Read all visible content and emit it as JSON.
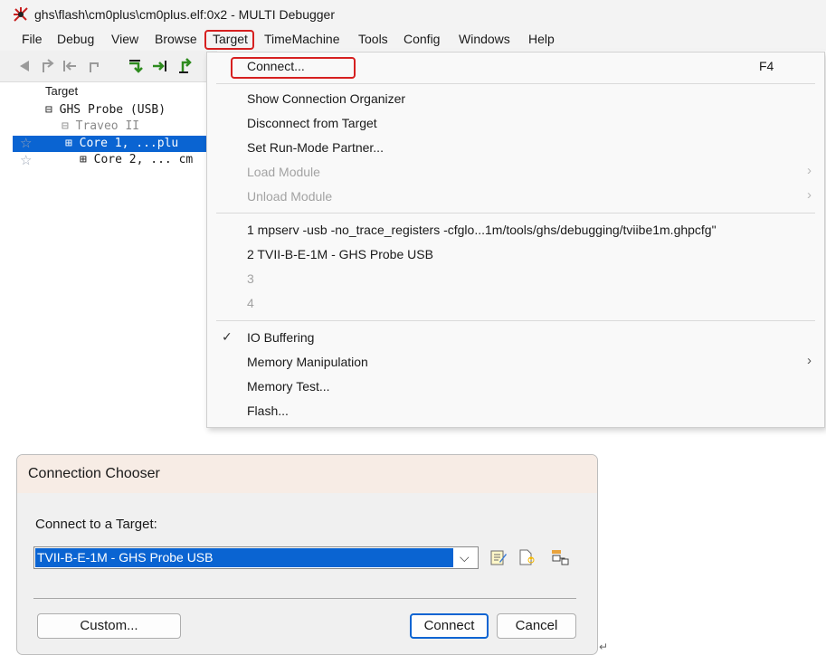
{
  "window": {
    "title": "ghs\\flash\\cm0plus\\cm0plus.elf:0x2 - MULTI Debugger"
  },
  "menubar": {
    "items": [
      "File",
      "Debug",
      "View",
      "Browse",
      "Target",
      "TimeMachine",
      "Tools",
      "Config",
      "Windows",
      "Help"
    ],
    "active": "Target"
  },
  "toolbar": {
    "icons": [
      "back-arrow-icon",
      "step-up-icon",
      "step-back-icon",
      "return-icon",
      "step-over-icon",
      "step-into-icon",
      "step-out-icon"
    ]
  },
  "tree": {
    "header": "Target",
    "probe": "⊟ GHS Probe (USB)",
    "device": "⊟ Traveo II",
    "core1": "⊞ Core 1, ...plu",
    "core2": "⊞ Core 2, ... cm"
  },
  "target_menu": {
    "connect": "Connect...",
    "connect_shortcut": "F4",
    "show_organizer": "Show Connection Organizer",
    "disconnect": "Disconnect from Target",
    "run_mode_partner": "Set Run-Mode Partner...",
    "load_module": "Load Module",
    "unload_module": "Unload Module",
    "recent1": "1 mpserv -usb -no_trace_registers -cfglo...1m/tools/ghs/debugging/tviibe1m.ghpcfg\"",
    "recent2": "2 TVII-B-E-1M - GHS Probe USB",
    "recent3": "3",
    "recent4": "4",
    "io_buffering": "IO Buffering",
    "io_buffering_checked": true,
    "memory_manipulation": "Memory Manipulation",
    "memory_test": "Memory Test...",
    "flash": "Flash..."
  },
  "dialog": {
    "title": "Connection Chooser",
    "label": "Connect to a Target:",
    "selected_target": "TVII-B-E-1M - GHS Probe USB",
    "buttons": {
      "custom": "Custom...",
      "connect": "Connect",
      "cancel": "Cancel"
    }
  },
  "colors": {
    "selection": "#0a64d2",
    "highlight_box": "#d62020",
    "dialog_title_bg": "#f7ece5"
  }
}
